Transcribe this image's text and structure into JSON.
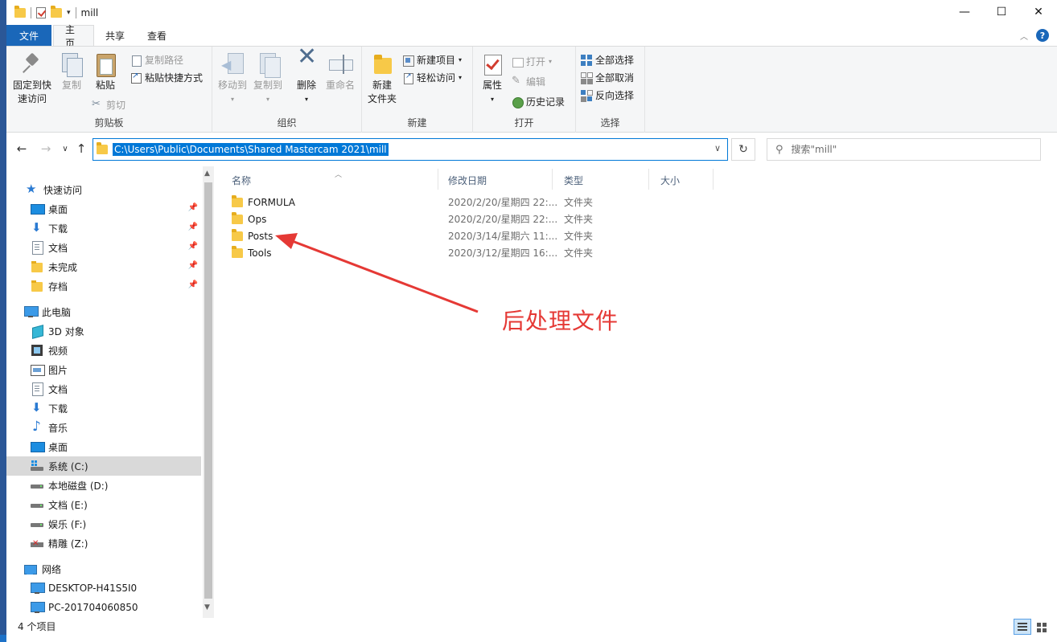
{
  "window": {
    "title": "mill",
    "controls": {
      "minimize": "—",
      "maximize": "☐",
      "close": "✕"
    }
  },
  "quick_access_toolbar": {
    "dropdown": "▾"
  },
  "ribbon_tabs": [
    {
      "label": "文件"
    },
    {
      "label": "主页"
    },
    {
      "label": "共享"
    },
    {
      "label": "查看"
    }
  ],
  "ribbon": {
    "clipboard": {
      "label": "剪贴板",
      "pin_quick_access": "固定到快\n速访问",
      "copy": "复制",
      "paste": "粘贴",
      "copy_path": "复制路径",
      "paste_shortcut": "粘贴快捷方式",
      "cut": "剪切"
    },
    "organize": {
      "label": "组织",
      "move_to": "移动到",
      "copy_to": "复制到",
      "delete": "删除",
      "rename": "重命名"
    },
    "new": {
      "label": "新建",
      "new_folder": "新建\n文件夹",
      "new_item": "新建项目",
      "easy_access": "轻松访问"
    },
    "open": {
      "label": "打开",
      "properties": "属性",
      "open": "打开",
      "edit": "编辑",
      "history": "历史记录"
    },
    "select": {
      "label": "选择",
      "select_all": "全部选择",
      "select_none": "全部取消",
      "invert": "反向选择"
    }
  },
  "address_bar": {
    "path": "C:\\Users\\Public\\Documents\\Shared Mastercam 2021\\mill",
    "search_placeholder": "搜索\"mill\""
  },
  "nav_buttons": {
    "back": "←",
    "forward": "→",
    "recent": "∨",
    "up": "↑",
    "refresh": "↻"
  },
  "nav_pane": {
    "quick_access_label": "快速访问",
    "quick_access": [
      {
        "label": "桌面",
        "icon": "desktop-icon"
      },
      {
        "label": "下载",
        "icon": "download-icon"
      },
      {
        "label": "文档",
        "icon": "document-icon"
      },
      {
        "label": "未完成",
        "icon": "folder-icon"
      },
      {
        "label": "存档",
        "icon": "folder-icon"
      }
    ],
    "this_pc_label": "此电脑",
    "this_pc": [
      {
        "label": "3D 对象",
        "icon": "3d-objects-icon"
      },
      {
        "label": "视频",
        "icon": "video-icon"
      },
      {
        "label": "图片",
        "icon": "pictures-icon"
      },
      {
        "label": "文档",
        "icon": "document-icon"
      },
      {
        "label": "下载",
        "icon": "download-icon"
      },
      {
        "label": "音乐",
        "icon": "music-icon"
      },
      {
        "label": "桌面",
        "icon": "desktop-icon"
      },
      {
        "label": "系统 (C:)",
        "icon": "system-drive-icon"
      },
      {
        "label": "本地磁盘 (D:)",
        "icon": "drive-icon"
      },
      {
        "label": "文档 (E:)",
        "icon": "drive-icon"
      },
      {
        "label": "娱乐 (F:)",
        "icon": "drive-icon"
      },
      {
        "label": "精雕 (Z:)",
        "icon": "network-drive-icon"
      }
    ],
    "network_label": "网络",
    "network": [
      {
        "label": "DESKTOP-H41S5I0",
        "icon": "computer-icon"
      },
      {
        "label": "PC-201704060850",
        "icon": "computer-icon"
      }
    ]
  },
  "file_list": {
    "columns": {
      "name": "名称",
      "date": "修改日期",
      "type": "类型",
      "size": "大小"
    },
    "rows": [
      {
        "name": "FORMULA",
        "date": "2020/2/20/星期四 22:...",
        "type": "文件夹"
      },
      {
        "name": "Ops",
        "date": "2020/2/20/星期四 22:...",
        "type": "文件夹"
      },
      {
        "name": "Posts",
        "date": "2020/3/14/星期六 11:...",
        "type": "文件夹"
      },
      {
        "name": "Tools",
        "date": "2020/3/12/星期四 16:...",
        "type": "文件夹"
      }
    ]
  },
  "annotation": {
    "text": "后处理文件",
    "color": "#e53935"
  },
  "status_bar": {
    "item_count": "4 个项目"
  },
  "colors": {
    "accent": "#0078d7",
    "file_tab": "#1a67b9",
    "folder": "#f7c948"
  }
}
